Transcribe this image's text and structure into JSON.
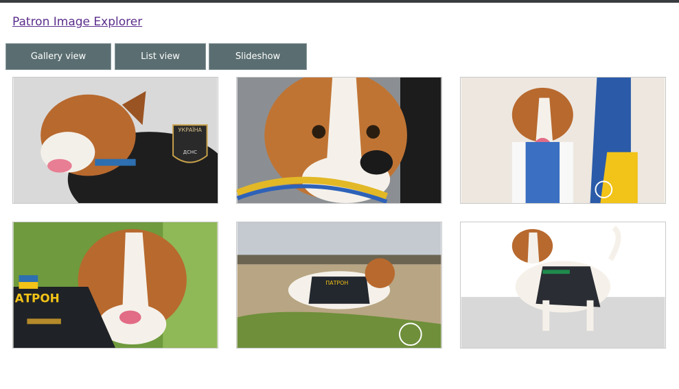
{
  "header": {
    "title": "Patron Image Explorer"
  },
  "tabs": [
    {
      "label": "Gallery view"
    },
    {
      "label": "List view"
    },
    {
      "label": "Slideshow"
    }
  ],
  "gallery": {
    "images": [
      {
        "subject": "dog-in-tactical-vest",
        "vest_text": "УКРАЇНА",
        "patch_text": "ДСНС"
      },
      {
        "subject": "dog-closeup-blue-yellow-collar"
      },
      {
        "subject": "dog-in-embroidered-shirt-with-flag"
      },
      {
        "subject": "dog-in-grass-with-patch",
        "vest_text": "АТРОН"
      },
      {
        "subject": "dog-in-field",
        "vest_text": "ПАТРОН"
      },
      {
        "subject": "dog-standing-on-pavement"
      }
    ]
  },
  "colors": {
    "tab_bg": "#5a6e71",
    "link": "#5a2d8c",
    "topbar": "#3a3d3f"
  }
}
